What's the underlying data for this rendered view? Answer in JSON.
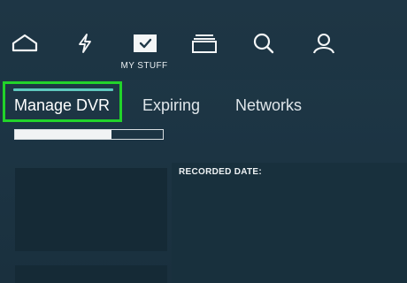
{
  "nav": {
    "items": [
      {
        "icon": "home-icon"
      },
      {
        "icon": "lightning-icon"
      },
      {
        "icon": "checkbox-icon",
        "label": "MY STUFF",
        "active": true
      },
      {
        "icon": "stack-icon"
      },
      {
        "icon": "search-icon"
      },
      {
        "icon": "profile-icon"
      }
    ],
    "active_label": "MY STUFF"
  },
  "tabs": [
    {
      "label": "Manage DVR",
      "active": true
    },
    {
      "label": "Expiring"
    },
    {
      "label": "Networks"
    }
  ],
  "storage": {
    "used_fraction": 0.65
  },
  "details": {
    "recorded_date_label": "RECORDED DATE:"
  },
  "colors": {
    "highlight": "#22d32a",
    "accent": "#5ec8bd",
    "background": "#1f3847"
  }
}
